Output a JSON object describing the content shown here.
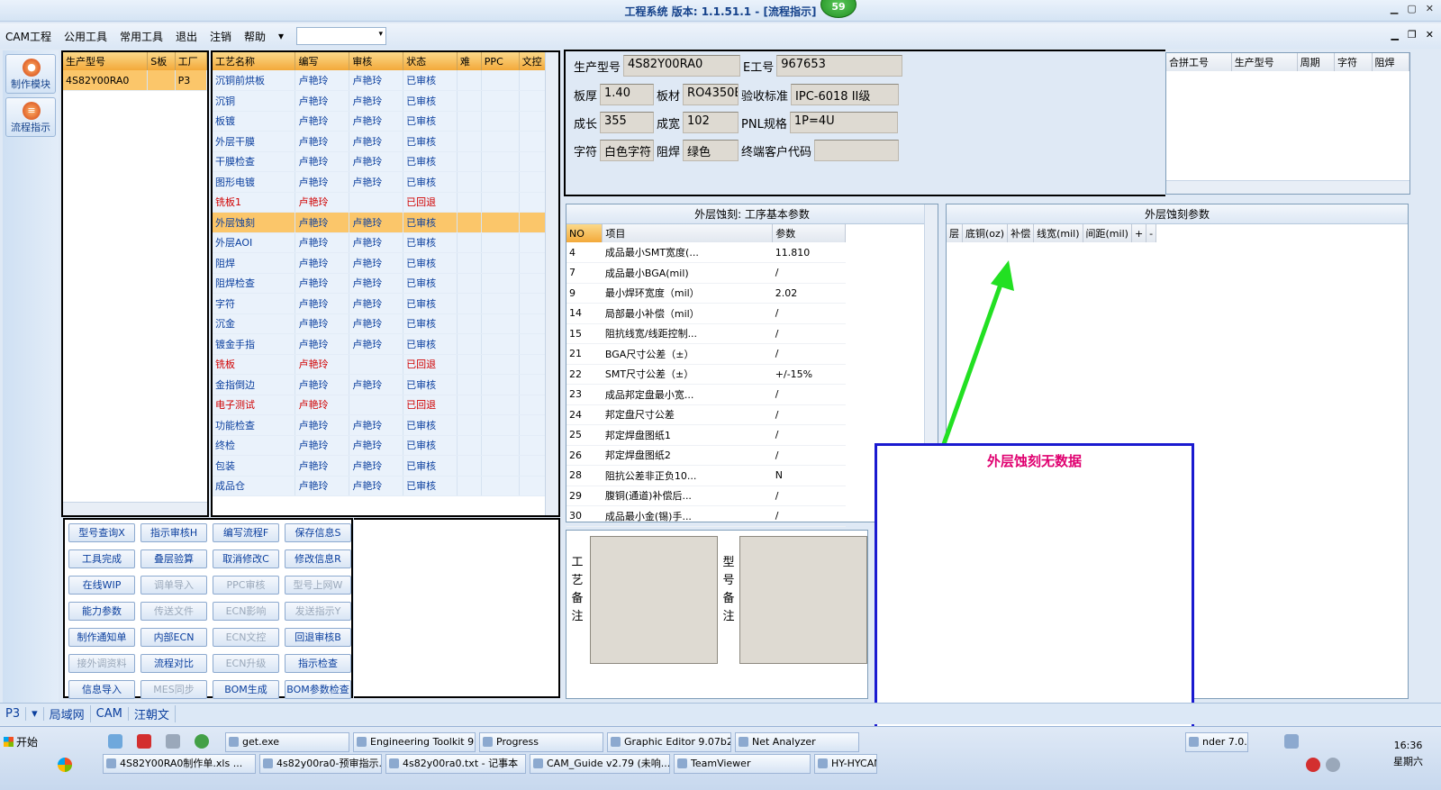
{
  "window": {
    "title": "工程系统  版本: 1.1.51.1 - [流程指示]",
    "badge": "59"
  },
  "menu": [
    "CAM工程",
    "公用工具",
    "常用工具",
    "退出",
    "注销",
    "帮助"
  ],
  "leftbar": [
    "制作模块",
    "流程指示"
  ],
  "models": {
    "headers": [
      "生产型号",
      "S板",
      "工厂"
    ],
    "rows": [
      [
        "4S82Y00RA0",
        "",
        "P3"
      ]
    ]
  },
  "process": {
    "headers": [
      "工艺名称",
      "编写",
      "审核",
      "状态",
      "难",
      "PPC",
      "文控"
    ],
    "rows": [
      [
        "沉铜前烘板",
        "卢艳玲",
        "卢艳玲",
        "已审核"
      ],
      [
        "沉铜",
        "卢艳玲",
        "卢艳玲",
        "已审核"
      ],
      [
        "板镀",
        "卢艳玲",
        "卢艳玲",
        "已审核"
      ],
      [
        "外层干膜",
        "卢艳玲",
        "卢艳玲",
        "已审核"
      ],
      [
        "干膜检查",
        "卢艳玲",
        "卢艳玲",
        "已审核"
      ],
      [
        "图形电镀",
        "卢艳玲",
        "卢艳玲",
        "已审核"
      ],
      [
        "铣板1",
        "卢艳玲",
        "",
        "已回退"
      ],
      [
        "外层蚀刻",
        "卢艳玲",
        "卢艳玲",
        "已审核"
      ],
      [
        "外层AOI",
        "卢艳玲",
        "卢艳玲",
        "已审核"
      ],
      [
        "阻焊",
        "卢艳玲",
        "卢艳玲",
        "已审核"
      ],
      [
        "阻焊检查",
        "卢艳玲",
        "卢艳玲",
        "已审核"
      ],
      [
        "字符",
        "卢艳玲",
        "卢艳玲",
        "已审核"
      ],
      [
        "沉金",
        "卢艳玲",
        "卢艳玲",
        "已审核"
      ],
      [
        "镀金手指",
        "卢艳玲",
        "卢艳玲",
        "已审核"
      ],
      [
        "铣板",
        "卢艳玲",
        "",
        "已回退"
      ],
      [
        "金指倒边",
        "卢艳玲",
        "卢艳玲",
        "已审核"
      ],
      [
        "电子测试",
        "卢艳玲",
        "",
        "已回退"
      ],
      [
        "功能检查",
        "卢艳玲",
        "卢艳玲",
        "已审核"
      ],
      [
        "终检",
        "卢艳玲",
        "卢艳玲",
        "已审核"
      ],
      [
        "包装",
        "卢艳玲",
        "卢艳玲",
        "已审核"
      ],
      [
        "成品仓",
        "卢艳玲",
        "卢艳玲",
        "已审核"
      ]
    ],
    "selected_index": 7,
    "red_indices": [
      6,
      14,
      16
    ]
  },
  "buttons": [
    [
      "型号查询X",
      true
    ],
    [
      "指示审核H",
      true
    ],
    [
      "编写流程F",
      true
    ],
    [
      "保存信息S",
      true
    ],
    [
      "工具完成",
      true
    ],
    [
      "叠层验算",
      true
    ],
    [
      "取消修改C",
      true
    ],
    [
      "修改信息R",
      true
    ],
    [
      "在线WIP",
      true
    ],
    [
      "调单导入",
      false
    ],
    [
      "PPC审核",
      false
    ],
    [
      "型号上网W",
      false
    ],
    [
      "能力参数",
      true
    ],
    [
      "传送文件",
      false
    ],
    [
      "ECN影响",
      false
    ],
    [
      "发送指示Y",
      false
    ],
    [
      "制作通知单",
      true
    ],
    [
      "内部ECN",
      true
    ],
    [
      "ECN文控",
      false
    ],
    [
      "回退审核B",
      true
    ],
    [
      "接外调资料",
      false
    ],
    [
      "流程对比",
      true
    ],
    [
      "ECN升级",
      false
    ],
    [
      "指示检查",
      true
    ],
    [
      "信息导入",
      true
    ],
    [
      "MES同步",
      false
    ],
    [
      "BOM生成",
      true
    ],
    [
      "BOM参数检查",
      true
    ]
  ],
  "info": {
    "model_label": "生产型号",
    "model": "4S82Y00RA0",
    "eno_label": "E工号",
    "eno": "967653",
    "thick_label": "板厚",
    "thick": "1.40",
    "mat_label": "板材",
    "mat": "RO4350B",
    "std_label": "验收标准",
    "std": "IPC-6018 II级",
    "len_label": "成长",
    "len": "355",
    "wid_label": "成宽",
    "wid": "102",
    "pnl_label": "PNL规格",
    "pnl": "1P=4U",
    "char_label": "字符",
    "char": "白色字符",
    "mask_label": "阻焊",
    "mask": "绿色",
    "cust_label": "终端客户代码",
    "cust": ""
  },
  "combine_headers": [
    "合拼工号",
    "生产型号",
    "周期",
    "字符",
    "阻焊"
  ],
  "params": {
    "title": "外层蚀刻: 工序基本参数",
    "headers": [
      "NO",
      "项目",
      "参数"
    ],
    "rows": [
      [
        "4",
        "成品最小SMT宽度(...",
        "11.810"
      ],
      [
        "7",
        "成品最小BGA(mil)",
        "/"
      ],
      [
        "9",
        "最小焊环宽度（mil）",
        "2.02"
      ],
      [
        "14",
        "局部最小补偿（mil）",
        "/"
      ],
      [
        "15",
        "阻抗线宽/线距控制...",
        "/"
      ],
      [
        "21",
        "BGA尺寸公差（±）",
        "/"
      ],
      [
        "22",
        "SMT尺寸公差（±）",
        "+/-15%"
      ],
      [
        "23",
        "成品邦定盘最小宽...",
        "/"
      ],
      [
        "24",
        "邦定盘尺寸公差",
        "/"
      ],
      [
        "25",
        "邦定焊盘图纸1",
        "/"
      ],
      [
        "26",
        "邦定焊盘图纸2",
        "/"
      ],
      [
        "28",
        "阻抗公差非正负10...",
        "N"
      ],
      [
        "29",
        "腹铜(通道)补偿后...",
        "/"
      ],
      [
        "30",
        "成品最小金(锡)手...",
        "/"
      ]
    ]
  },
  "etch": {
    "title": "外层蚀刻参数",
    "headers": [
      "层",
      "底铜(oz)",
      "补偿",
      "线宽(mil)",
      "间距(mil)",
      "+",
      "-"
    ]
  },
  "notes": {
    "a": "工艺备注",
    "b": "型号备注"
  },
  "overlay_text": "外层蚀刻无数据",
  "status": [
    "P3",
    "局域网",
    "CAM",
    "汪朝文"
  ],
  "taskbar": {
    "start": "开始",
    "row1": [
      "get.exe",
      "Engineering Toolkit 9....",
      "Progress",
      "Graphic Editor 9.07b2...",
      "Net Analyzer",
      "nder 7.0..."
    ],
    "row2": [
      "4S82Y00RA0制作单.xls ...",
      "4s82y00ra0-预审指示.x...",
      "4s82y00ra0.txt - 记事本",
      "CAM_Guide v2.79 (未响...",
      "TeamViewer",
      "HY-HYCAM"
    ],
    "time": "16:36",
    "day": "星期六"
  }
}
